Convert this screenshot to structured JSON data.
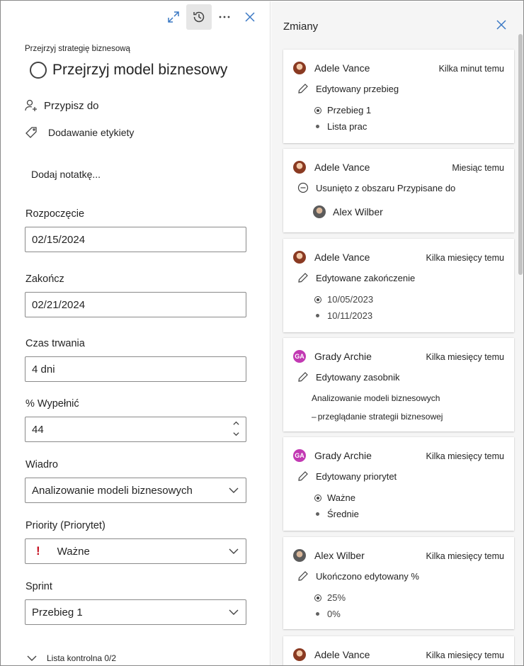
{
  "left": {
    "breadcrumb": "Przejrzyj strategię biznesową",
    "title": "Przejrzyj model biznesowy",
    "assign": "Przypisz do",
    "label": "Dodawanie etykiety",
    "note": "Dodaj notatkę...",
    "start": {
      "label": "Rozpoczęcie",
      "value": "02/15/2024"
    },
    "end": {
      "label": "Zakończ",
      "value": "02/21/2024"
    },
    "duration": {
      "label": "Czas trwania",
      "value": "4 dni"
    },
    "percent": {
      "label": "% Wypełnić",
      "value": "44"
    },
    "bucket": {
      "label": "Wiadro",
      "value": "Analizowanie modeli biznesowych"
    },
    "priority": {
      "label": "Priority (Priorytet)",
      "value": "Ważne",
      "mark": "!"
    },
    "sprint": {
      "label": "Sprint",
      "value": "Przebieg 1"
    },
    "checklist": "Lista kontrolna 0/2"
  },
  "right": {
    "title": "Zmiany",
    "cards": [
      {
        "user": "Adele Vance",
        "time": "Kilka minut temu",
        "action": "Edytowany przebieg",
        "from": "Przebieg 1",
        "to": "Lista prac"
      },
      {
        "user": "Adele Vance",
        "time": "Miesiąc temu",
        "action": "Usunięto z obszaru Przypisane do",
        "person": "Alex Wilber"
      },
      {
        "user": "Adele Vance",
        "time": "Kilka miesięcy temu",
        "action": "Edytowane zakończenie",
        "from": "10/05/2023",
        "to": "10/11/2023"
      },
      {
        "user": "Grady Archie",
        "initials": "GA",
        "time": "Kilka miesięcy temu",
        "action": "Edytowany zasobnik",
        "from": "Analizowanie modeli biznesowych",
        "to": "przeglądanie strategii biznesowej"
      },
      {
        "user": "Grady Archie",
        "initials": "GA",
        "time": "Kilka miesięcy temu",
        "action": "Edytowany priorytet",
        "from": "Ważne",
        "to": "Średnie"
      },
      {
        "user": "Alex Wilber",
        "time": "Kilka miesięcy temu",
        "action": "Ukończono edytowany %",
        "from": "25%",
        "to": "0%"
      },
      {
        "user": "Adele Vance",
        "time": "Kilka miesięcy temu"
      }
    ]
  },
  "colors": {
    "priority_red": "#c50f1f",
    "avatar_ga": "#c239b3",
    "panel_bg": "#f5f5f5"
  },
  "icons": [
    "expand-icon",
    "history-icon",
    "more-icon",
    "close-icon",
    "person-add-icon",
    "tag-icon",
    "chevron-down-icon",
    "pencil-icon",
    "remove-circle-icon"
  ]
}
